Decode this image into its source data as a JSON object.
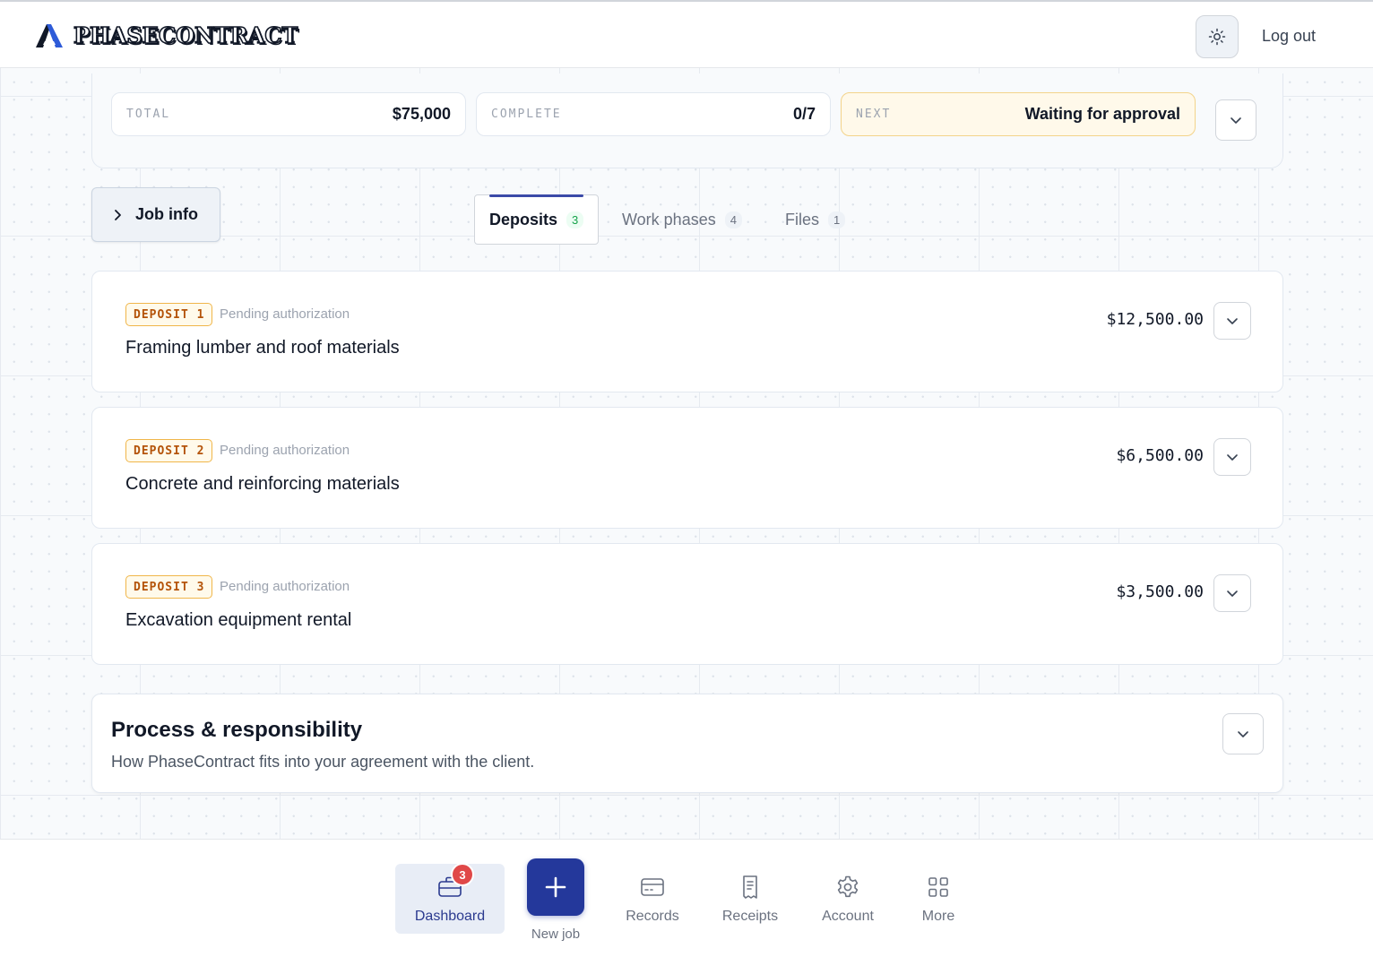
{
  "header": {
    "brand": "PHASECONTRACT",
    "theme_icon": "sun-icon",
    "logout_label": "Log out"
  },
  "summary": {
    "total_label": "TOTAL",
    "total_value": "$75,000",
    "complete_label": "COMPLETE",
    "complete_value": "0/7",
    "next_label": "NEXT",
    "next_value": "Waiting for approval"
  },
  "job_info_label": "Job info",
  "tabs": [
    {
      "label": "Deposits",
      "count": "3",
      "active": true
    },
    {
      "label": "Work phases",
      "count": "4",
      "active": false
    },
    {
      "label": "Files",
      "count": "1",
      "active": false
    }
  ],
  "deposits": [
    {
      "badge": "DEPOSIT 1",
      "status": "Pending authorization",
      "title": "Framing lumber and roof materials",
      "amount": "$12,500.00"
    },
    {
      "badge": "DEPOSIT 2",
      "status": "Pending authorization",
      "title": "Concrete and reinforcing materials",
      "amount": "$6,500.00"
    },
    {
      "badge": "DEPOSIT 3",
      "status": "Pending authorization",
      "title": "Excavation equipment rental",
      "amount": "$3,500.00"
    }
  ],
  "process": {
    "title": "Process & responsibility",
    "description": "How PhaseContract fits into your agreement with the client."
  },
  "bottom_nav": {
    "dashboard_label": "Dashboard",
    "dashboard_badge": "3",
    "new_job_label": "New job",
    "records_label": "Records",
    "receipts_label": "Receipts",
    "account_label": "Account",
    "more_label": "More"
  },
  "colors": {
    "accent": "#24389b",
    "badge_red": "#e04848",
    "deposit_badge": "#b45309",
    "next_bg": "#fff9ea"
  }
}
